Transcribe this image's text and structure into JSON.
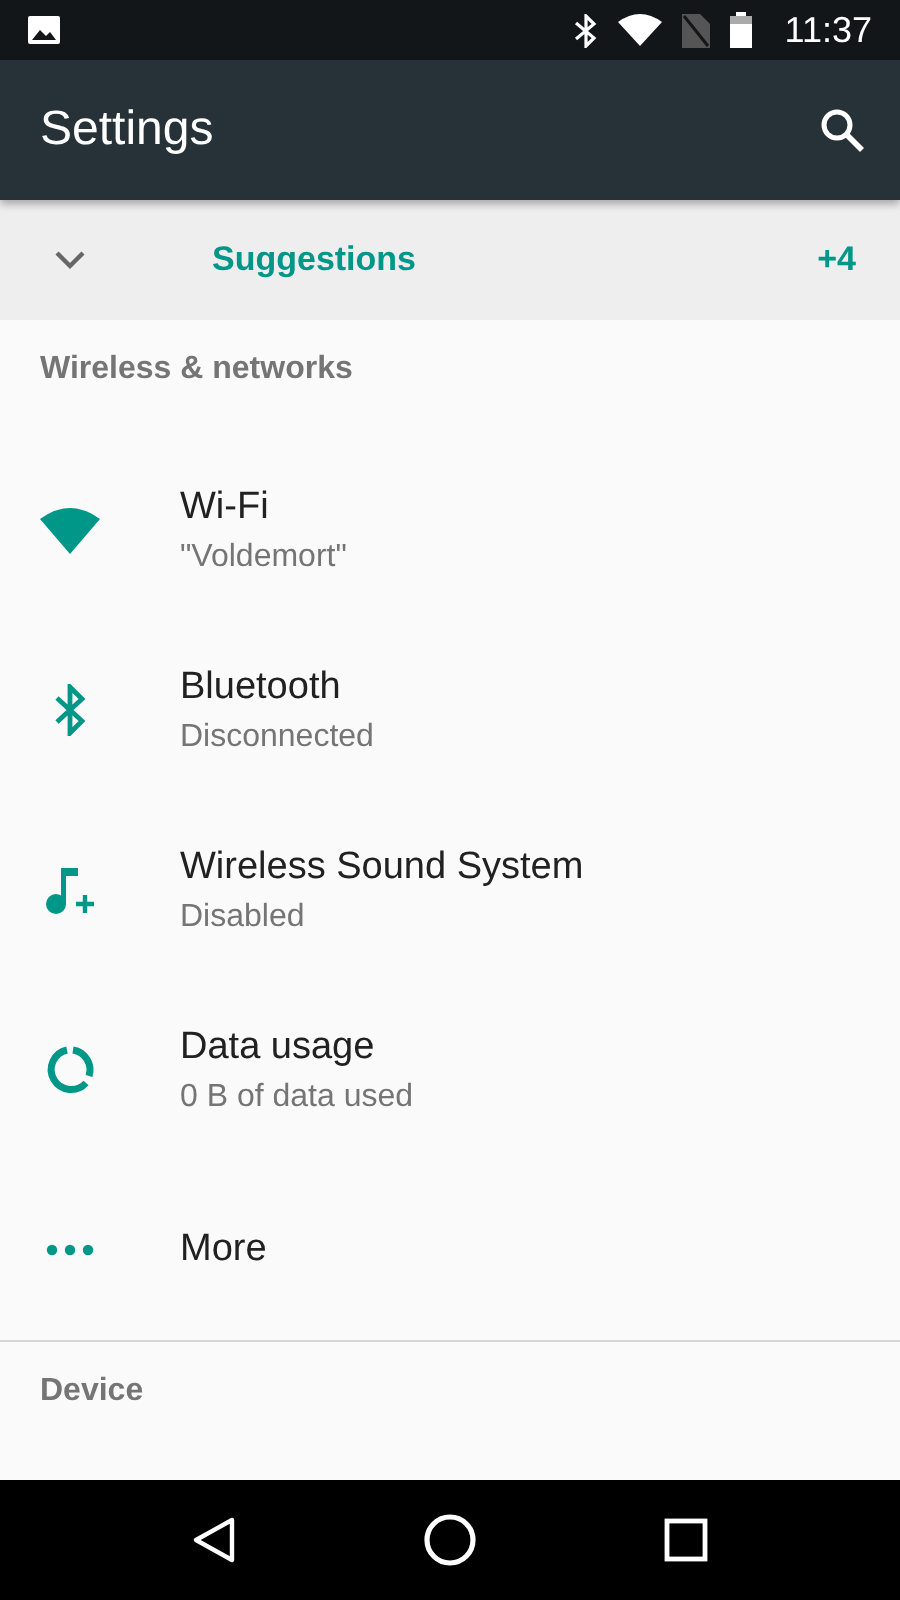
{
  "status_bar": {
    "time": "11:37"
  },
  "app_bar": {
    "title": "Settings"
  },
  "suggestions": {
    "label": "Suggestions",
    "count": "+4",
    "expanded": false
  },
  "sections": [
    {
      "header": "Wireless & networks",
      "items": [
        {
          "kind": "wifi",
          "title": "Wi-Fi",
          "subtitle": "\"Voldemort\""
        },
        {
          "kind": "bluetooth",
          "title": "Bluetooth",
          "subtitle": "Disconnected"
        },
        {
          "kind": "music",
          "title": "Wireless Sound System",
          "subtitle": "Disabled"
        },
        {
          "kind": "data",
          "title": "Data usage",
          "subtitle": "0 B of data used"
        },
        {
          "kind": "more",
          "title": "More"
        }
      ]
    },
    {
      "header": "Device"
    }
  ]
}
